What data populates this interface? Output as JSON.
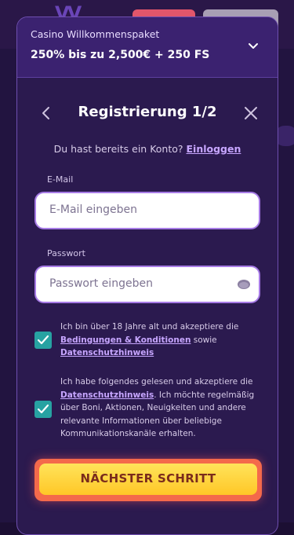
{
  "promo": {
    "subtitle": "Casino Willkommenspaket",
    "title": "250% bis zu 2,500€ + 250 FS"
  },
  "header": {
    "title": "Registrierung 1/2"
  },
  "login": {
    "prompt": "Du hast bereits ein Konto?",
    "link": "Einloggen"
  },
  "email": {
    "label": "E-Mail",
    "placeholder": "E-Mail eingeben"
  },
  "password": {
    "label": "Passwort",
    "placeholder": "Passwort eingeben"
  },
  "consent1": {
    "checked": true,
    "text_before": "Ich bin über 18 Jahre alt und akzeptiere die",
    "link1": "Bedingungen & Konditionen",
    "text_mid": "sowie",
    "link2": "Datenschutzhinweis"
  },
  "consent2": {
    "checked": true,
    "text_before": "Ich habe folgendes gelesen und akzeptiere die",
    "link": "Datenschutzhinweis",
    "text_after": ". Ich möchte regelmäßig über Boni, Aktionen, Neuigkeiten und andere relevante Informationen über beliebige Kommunikationskanäle erhalten."
  },
  "next_button": {
    "label": "NÄCHSTER SCHRITT"
  },
  "colors": {
    "accent": "#a77be6",
    "link": "#c7a6ff",
    "checkbox": "#27a2a2",
    "button_fill": "#ffd23f",
    "button_border": "#f4694b"
  }
}
